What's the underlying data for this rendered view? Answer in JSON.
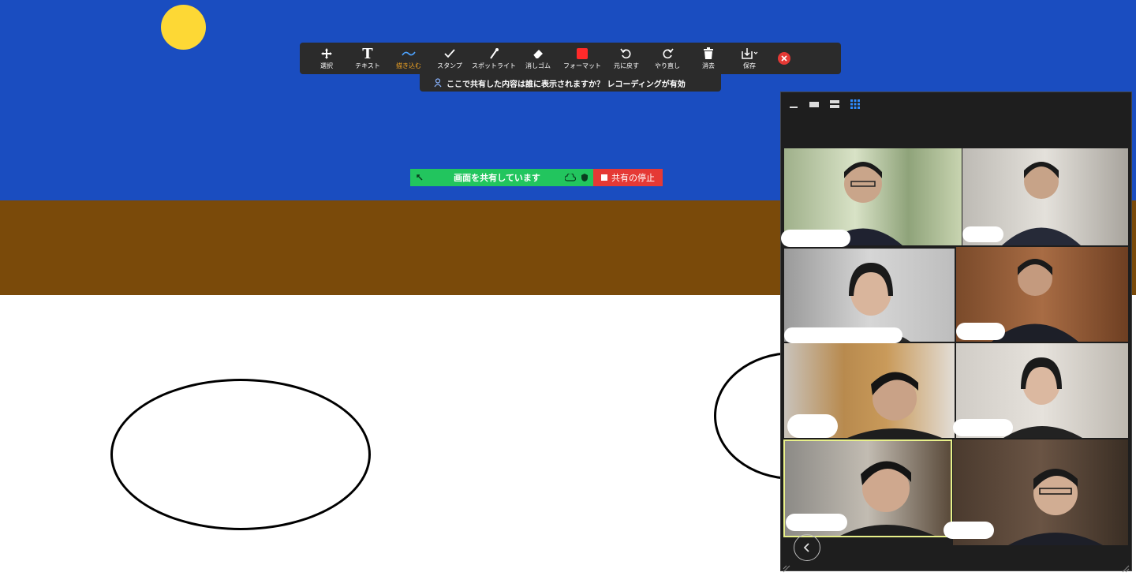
{
  "toolbar": {
    "tools": [
      {
        "label": "選択",
        "icon": "move-icon"
      },
      {
        "label": "テキスト",
        "icon": "text-icon"
      },
      {
        "label": "描き込む",
        "icon": "draw-icon",
        "active": true
      },
      {
        "label": "スタンプ",
        "icon": "checkmark-icon"
      },
      {
        "label": "スポットライト",
        "icon": "spotlight-icon"
      },
      {
        "label": "消しゴム",
        "icon": "eraser-icon"
      },
      {
        "label": "フォーマット",
        "icon": "format-icon"
      },
      {
        "label": "元に戻す",
        "icon": "undo-icon"
      },
      {
        "label": "やり直し",
        "icon": "redo-icon"
      },
      {
        "label": "消去",
        "icon": "trash-icon"
      },
      {
        "label": "保存",
        "icon": "save-icon"
      }
    ]
  },
  "notice": {
    "text": "ここで共有した内容は誰に表示されますか？ レコーディングが有効"
  },
  "share_bar": {
    "status": "画面を共有しています",
    "stop_label": "共有の停止"
  },
  "colors": {
    "sky": "#1a4dc0",
    "ground": "#7a4a0a",
    "sun": "#fdd835",
    "share_green": "#22c55e",
    "stop_red": "#e53935",
    "active_tool": "#f5a623",
    "format_red": "#ff2a2a",
    "active_speaker_border": "#e8f08a"
  },
  "gallery": {
    "view_icons": [
      "minimize-icon",
      "speaker-view-icon",
      "strip-view-icon",
      "gallery-view-icon"
    ],
    "participant_count": 8
  }
}
